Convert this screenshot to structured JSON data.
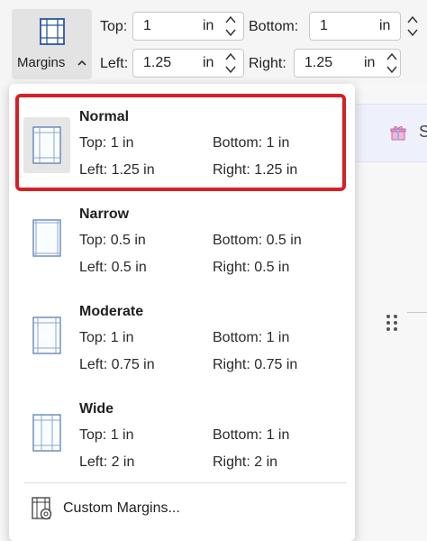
{
  "ribbon": {
    "margins_label": "Margins",
    "fields": {
      "top": {
        "label": "Top:",
        "value": "1",
        "unit": "in"
      },
      "bottom": {
        "label": "Bottom:",
        "value": "1",
        "unit": "in"
      },
      "left": {
        "label": "Left:",
        "value": "1.25",
        "unit": "in"
      },
      "right": {
        "label": "Right:",
        "value": "1.25",
        "unit": "in"
      }
    }
  },
  "background": {
    "strip_letter": "S"
  },
  "presets": [
    {
      "name": "Normal",
      "top": "Top: 1 in",
      "bottom": "Bottom: 1 in",
      "left": "Left: 1.25 in",
      "right": "Right: 1.25 in",
      "selected": true
    },
    {
      "name": "Narrow",
      "top": "Top: 0.5 in",
      "bottom": "Bottom: 0.5 in",
      "left": "Left: 0.5 in",
      "right": "Right: 0.5 in",
      "selected": false
    },
    {
      "name": "Moderate",
      "top": "Top: 1 in",
      "bottom": "Bottom: 1 in",
      "left": "Left: 0.75 in",
      "right": "Right: 0.75 in",
      "selected": false
    },
    {
      "name": "Wide",
      "top": "Top: 1 in",
      "bottom": "Bottom: 1 in",
      "left": "Left: 2 in",
      "right": "Right: 2 in",
      "selected": false
    }
  ],
  "custom_margins_label": "Custom Margins...",
  "colors": {
    "highlight": "#d62024",
    "accent": "#2b579a",
    "popup_bg": "#ffffff"
  },
  "icons": {
    "margins": "margins-icon",
    "caret": "caret-up-icon",
    "spin": "spin-arrows-icon",
    "page": "page-margin-icon",
    "custom": "custom-margins-icon",
    "gift": "gift-icon",
    "drag": "drag-handle-icon"
  }
}
